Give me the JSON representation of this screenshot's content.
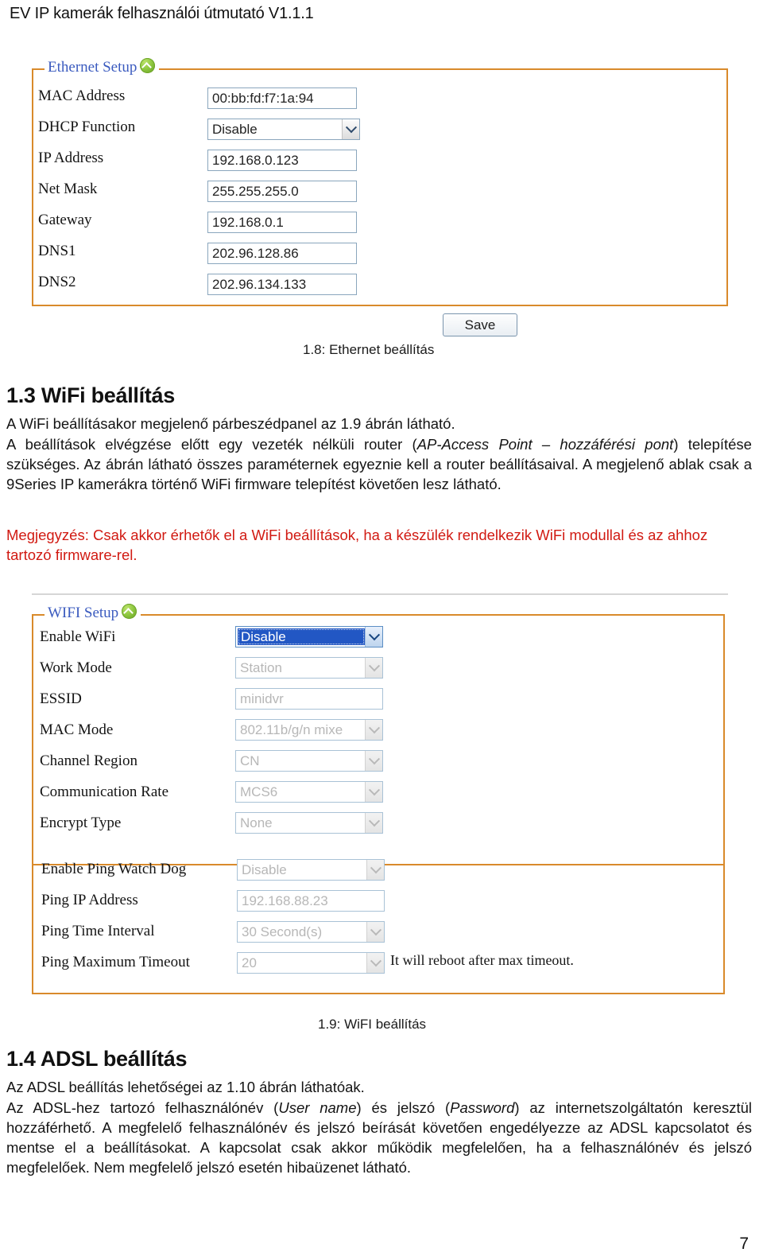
{
  "document": {
    "running_header": "EV IP kamerák felhasználói útmutató V1.1.1",
    "page_number": "7"
  },
  "ethernet_panel": {
    "legend": "Ethernet Setup",
    "collapse_icon": "chevron-up-circle-icon",
    "rows": [
      {
        "label": "MAC Address",
        "type": "text",
        "value": "00:bb:fd:f7:1a:94",
        "disabled": false
      },
      {
        "label": "DHCP Function",
        "type": "select",
        "value": "Disable",
        "disabled": false
      },
      {
        "label": "IP Address",
        "type": "text",
        "value": "192.168.0.123",
        "disabled": false
      },
      {
        "label": "Net Mask",
        "type": "text",
        "value": "255.255.255.0",
        "disabled": false
      },
      {
        "label": "Gateway",
        "type": "text",
        "value": "192.168.0.1",
        "disabled": false
      },
      {
        "label": "DNS1",
        "type": "text",
        "value": "202.96.128.86",
        "disabled": false
      },
      {
        "label": "DNS2",
        "type": "text",
        "value": "202.96.134.133",
        "disabled": false
      }
    ],
    "save_label": "Save",
    "caption": "1.8: Ethernet beállítás"
  },
  "section_wifi": {
    "heading": "1.3 WiFi beállítás",
    "p1": "A WiFi beállításakor megjelenő párbeszédpanel az 1.9 ábrán látható.",
    "p2_a": "A beállítások elvégzése előtt egy vezeték nélküli router (",
    "p2_em1": "AP-Access Point – hozzáférési pont",
    "p2_b": ") telepítése szükséges. Az ábrán látható összes paraméternek egyeznie kell a router beállításaival. A megjelenő ablak csak a 9Series IP kamerákra történő WiFi firmware telepítést követően lesz látható.",
    "note": "Megjegyzés: Csak akkor érhetők el a WiFi beállítások, ha a készülék rendelkezik WiFi modullal és az ahhoz tartozó firmware-rel."
  },
  "wifi_panel": {
    "legend": "WIFI Setup",
    "collapse_icon": "chevron-up-circle-icon",
    "rows_top": [
      {
        "label": "Enable WiFi",
        "type": "select",
        "value": "Disable",
        "disabled": false,
        "focused": true
      },
      {
        "label": "Work Mode",
        "type": "select",
        "value": "Station",
        "disabled": true,
        "focused": false
      },
      {
        "label": "ESSID",
        "type": "text",
        "value": "minidvr",
        "disabled": true,
        "focused": false
      },
      {
        "label": "MAC Mode",
        "type": "select",
        "value": "802.11b/g/n mixe",
        "disabled": true,
        "focused": false
      },
      {
        "label": "Channel Region",
        "type": "select",
        "value": "CN",
        "disabled": true,
        "focused": false
      },
      {
        "label": "Communication Rate",
        "type": "select",
        "value": "MCS6",
        "disabled": true,
        "focused": false
      },
      {
        "label": "Encrypt Type",
        "type": "select",
        "value": "None",
        "disabled": true,
        "focused": false
      }
    ],
    "rows_bottom": [
      {
        "label": "Enable Ping Watch Dog",
        "type": "select",
        "value": "Disable",
        "disabled": true,
        "focused": false,
        "hint": ""
      },
      {
        "label": "Ping IP Address",
        "type": "text",
        "value": "192.168.88.23",
        "disabled": true,
        "focused": false,
        "hint": ""
      },
      {
        "label": "Ping Time Interval",
        "type": "select",
        "value": "30 Second(s)",
        "disabled": true,
        "focused": false,
        "hint": ""
      },
      {
        "label": "Ping Maximum Timeout",
        "type": "select",
        "value": "20",
        "disabled": true,
        "focused": false,
        "hint": "It will reboot after max timeout."
      }
    ],
    "caption": "1.9: WiFI beállítás"
  },
  "section_adsl": {
    "heading": "1.4 ADSL beállítás",
    "p1": "Az ADSL beállítás lehetőségei az 1.10 ábrán láthatóak.",
    "p2_a": "Az ADSL-hez tartozó felhasználónév (",
    "p2_em1": "User name",
    "p2_b": ") és jelszó (",
    "p2_em2": "Password",
    "p2_c": ") az internetszolgáltatón keresztül hozzáférhető. A megfelelő felhasználónév és jelszó beírását követően engedélyezze az ADSL kapcsolatot és mentse el a beállításokat. A kapcsolat csak akkor működik megfelelően, ha a felhasználónév és jelszó megfelelőek. Nem megfelelő jelszó esetén hibaüzenet látható."
  },
  "colors": {
    "panel_border": "#d98a2b",
    "legend_text": "#3b5bbf",
    "note_text": "#d11a12",
    "focus_fill": "#2257c4"
  }
}
